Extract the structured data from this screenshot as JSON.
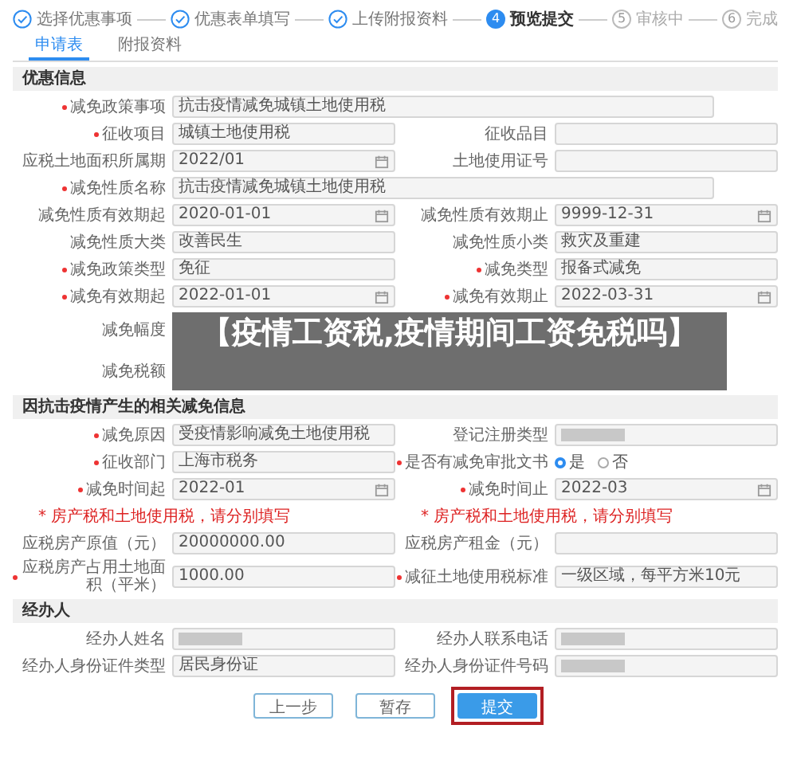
{
  "steps": [
    {
      "label": "选择优惠事项",
      "kind": "done"
    },
    {
      "label": "优惠表单填写",
      "kind": "done"
    },
    {
      "label": "上传附报资料",
      "kind": "done"
    },
    {
      "number": "4",
      "label": "预览提交",
      "kind": "current"
    },
    {
      "number": "5",
      "label": "审核中",
      "kind": "todo"
    },
    {
      "number": "6",
      "label": "完成",
      "kind": "todo"
    }
  ],
  "tabs": [
    {
      "label": "申请表",
      "selected": true
    },
    {
      "label": "附报资料",
      "selected": false
    }
  ],
  "sections": [
    {
      "title": "优惠信息",
      "rows": [
        {
          "kind": "full",
          "fields": [
            {
              "label": "减免政策事项",
              "required": true,
              "kind": "text",
              "value": "抗击疫情减免城镇土地使用税"
            }
          ]
        },
        {
          "kind": "pair",
          "fields": [
            {
              "label": "征收项目",
              "required": true,
              "kind": "text",
              "value": "城镇土地使用税"
            },
            {
              "label": "征收品目",
              "required": false,
              "kind": "text"
            }
          ]
        },
        {
          "kind": "pair",
          "fields": [
            {
              "label": "应税土地面积所属期",
              "required": false,
              "kind": "select",
              "value": "2022/01"
            },
            {
              "label": "土地使用证号",
              "required": false,
              "kind": "text"
            }
          ]
        },
        {
          "kind": "full",
          "fields": [
            {
              "label": "减免性质名称",
              "required": true,
              "kind": "text",
              "value": "抗击疫情减免城镇土地使用税"
            }
          ]
        },
        {
          "kind": "pair",
          "fields": [
            {
              "label": "减免性质有效期起",
              "required": false,
              "kind": "select",
              "value": "2020-01-01"
            },
            {
              "label": "减免性质有效期止",
              "required": false,
              "kind": "select",
              "value": "9999-12-31"
            }
          ]
        },
        {
          "kind": "pair",
          "fields": [
            {
              "label": "减免性质大类",
              "required": false,
              "kind": "text",
              "value": "改善民生"
            },
            {
              "label": "减免性质小类",
              "required": false,
              "kind": "text",
              "value": "救灾及重建"
            }
          ]
        },
        {
          "kind": "pair",
          "fields": [
            {
              "label": "减免政策类型",
              "required": true,
              "kind": "text",
              "value": "免征"
            },
            {
              "label": "减免类型",
              "required": true,
              "kind": "text",
              "value": "报备式减免"
            }
          ]
        },
        {
          "kind": "pair",
          "fields": [
            {
              "label": "减免有效期起",
              "required": true,
              "kind": "select",
              "value": "2022-01-01"
            },
            {
              "label": "减免有效期止",
              "required": true,
              "kind": "select",
              "value": "2022-03-31"
            }
          ]
        },
        {
          "kind": "covered",
          "fields": [
            {
              "label": "减免幅度",
              "required": false,
              "kind": "covered"
            }
          ]
        },
        {
          "kind": "covered",
          "fields": [
            {
              "label": "减免税额",
              "required": false,
              "kind": "covered"
            }
          ]
        }
      ]
    },
    {
      "title": "因抗击疫情产生的相关减免信息",
      "rows": [
        {
          "kind": "pair",
          "fields": [
            {
              "label": "减免原因",
              "required": true,
              "kind": "text",
              "value": "受疫情影响减免土地使用税"
            },
            {
              "label": "登记注册类型",
              "required": false,
              "kind": "masked"
            }
          ]
        },
        {
          "kind": "pair",
          "fields": [
            {
              "label": "征收部门",
              "required": true,
              "kind": "text",
              "value": "上海市税务"
            },
            {
              "label": "是否有减免审批文书",
              "required": true,
              "kind": "radio",
              "options": [
                {
                  "label": "是",
                  "selected": true
                },
                {
                  "label": "否",
                  "selected": false
                }
              ]
            }
          ]
        },
        {
          "kind": "pair",
          "fields": [
            {
              "label": "减免时间起",
              "required": true,
              "kind": "select",
              "value": "2022-01"
            },
            {
              "label": "减免时间止",
              "required": true,
              "kind": "select",
              "value": "2022-03"
            }
          ]
        },
        {
          "kind": "note",
          "notes": [
            "* 房产税和土地使用税，请分别填写",
            "* 房产税和土地使用税，请分别填写"
          ]
        },
        {
          "kind": "pair",
          "fields": [
            {
              "label": "应税房产原值（元）",
              "required": false,
              "kind": "text",
              "value": "20000000.00"
            },
            {
              "label": "应税房产租金（元）",
              "required": false,
              "kind": "text"
            }
          ]
        },
        {
          "kind": "pair",
          "fields": [
            {
              "label": "应税房产占用土地面积（平米）",
              "required": true,
              "kind": "text",
              "value": "1000.00"
            },
            {
              "label": "减征土地使用税标准",
              "required": true,
              "kind": "text",
              "value": "一级区域，每平方米10元"
            }
          ]
        }
      ]
    },
    {
      "title": "经办人",
      "rows": [
        {
          "kind": "pair",
          "fields": [
            {
              "label": "经办人姓名",
              "required": false,
              "kind": "masked"
            },
            {
              "label": "经办人联系电话",
              "required": false,
              "kind": "masked"
            }
          ]
        },
        {
          "kind": "pair",
          "fields": [
            {
              "label": "经办人身份证件类型",
              "required": false,
              "kind": "text",
              "value": "居民身份证"
            },
            {
              "label": "经办人身份证件号码",
              "required": false,
              "kind": "masked"
            }
          ]
        }
      ]
    }
  ],
  "buttons": [
    {
      "label": "上一步",
      "kind": "outline",
      "highlighted": false
    },
    {
      "label": "暂存",
      "kind": "outline",
      "highlighted": false
    },
    {
      "label": "提交",
      "kind": "primary",
      "highlighted": true
    }
  ],
  "banner": {
    "title": "【疫情工资税,疫情期间工资免税吗】"
  }
}
